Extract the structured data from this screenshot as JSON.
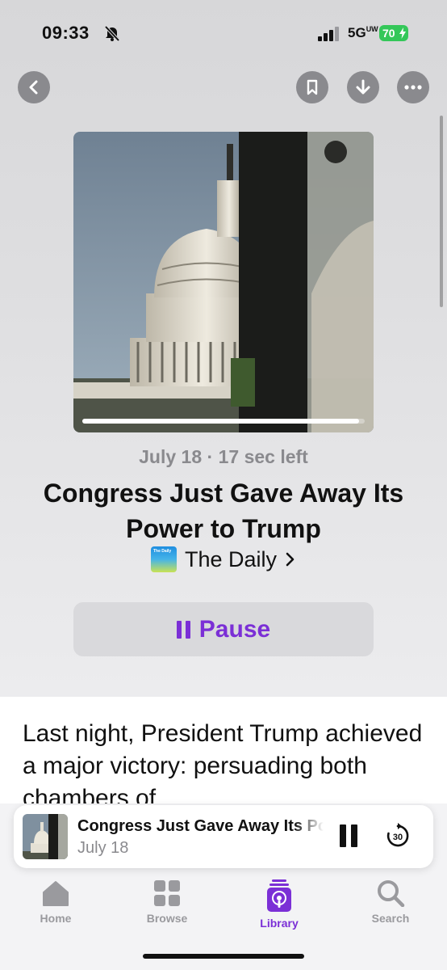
{
  "status_bar": {
    "time": "09:33",
    "network": "5G",
    "network_sub": "UW",
    "battery": "70"
  },
  "episode": {
    "date": "July 18",
    "separator": "·",
    "time_left": "17 sec left",
    "progress": 0.98,
    "title": "Congress Just Gave Away Its Power to Trump",
    "show": "The Daily",
    "show_thumb_text": "The Daily",
    "pause_label": "Pause",
    "description": "Last night, President Trump achieved a major victory: persuading both chambers of"
  },
  "mini_player": {
    "title": "Congress Just Gave Away Its Power to Trump",
    "date": "July 18",
    "skip_seconds": "30"
  },
  "tabs": [
    {
      "label": "Home",
      "icon": "house-icon"
    },
    {
      "label": "Browse",
      "icon": "grid-icon"
    },
    {
      "label": "Library",
      "icon": "podcast-library-icon",
      "active": true
    },
    {
      "label": "Search",
      "icon": "magnifier-icon"
    }
  ],
  "colors": {
    "accent": "#7b2fd6",
    "battery": "#34c759",
    "secondary_text": "#8a8a8e"
  }
}
